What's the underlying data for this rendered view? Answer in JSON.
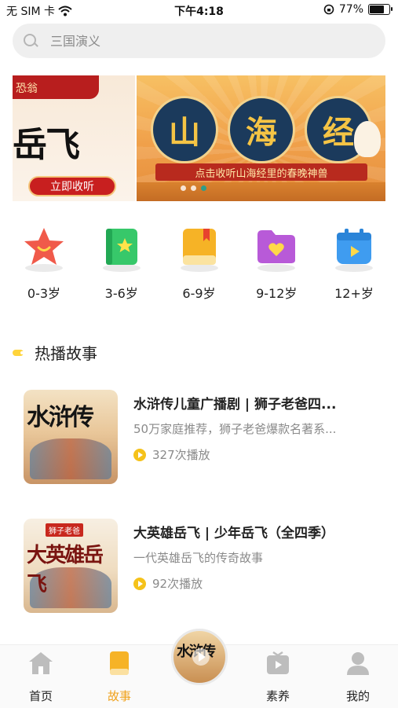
{
  "status_bar": {
    "carrier": "无 SIM 卡",
    "time": "下午4:18",
    "battery": "77%",
    "battery_level": 0.77
  },
  "search": {
    "placeholder": "三国演义"
  },
  "banners": [
    {
      "title": "岳飞",
      "corner_text": "恐翁",
      "button": "立即收听"
    },
    {
      "title_chars": [
        "山",
        "海",
        "经"
      ],
      "subtitle": "点击收听山海经里的春晚神兽"
    }
  ],
  "banner_dots": {
    "count": 3,
    "active": 2
  },
  "categories": [
    {
      "label": "0-3岁",
      "icon": "star-icon",
      "color": "#f05a4a"
    },
    {
      "label": "3-6岁",
      "icon": "green-book-icon",
      "color": "#37c86a"
    },
    {
      "label": "6-9岁",
      "icon": "yellow-book-icon",
      "color": "#f6b326"
    },
    {
      "label": "9-12岁",
      "icon": "purple-folder-heart-icon",
      "color": "#b85ad8"
    },
    {
      "label": "12+岁",
      "icon": "blue-calendar-play-icon",
      "color": "#3f9cf0"
    }
  ],
  "hot_section": {
    "title": "热播故事"
  },
  "stories": [
    {
      "cover_text": "水浒传",
      "title": "水浒传儿童广播剧 | 狮子老爸四...",
      "desc": "50万家庭推荐，狮子老爸爆款名著系...",
      "plays": "327次播放"
    },
    {
      "cover_tag": "狮子老爸",
      "cover_text": "大英雄岳飞",
      "title": "大英雄岳飞 | 少年岳飞（全四季）",
      "desc": "一代英雄岳飞的传奇故事",
      "plays": "92次播放"
    }
  ],
  "tabbar": {
    "tabs": [
      {
        "label": "首页",
        "icon": "home-icon"
      },
      {
        "label": "故事",
        "icon": "book-icon",
        "active": true
      },
      {
        "label": "素养",
        "icon": "tv-play-icon"
      },
      {
        "label": "我的",
        "icon": "person-icon"
      }
    ],
    "now_playing_cover": "水浒传",
    "accent_color": "#f0a21c"
  }
}
